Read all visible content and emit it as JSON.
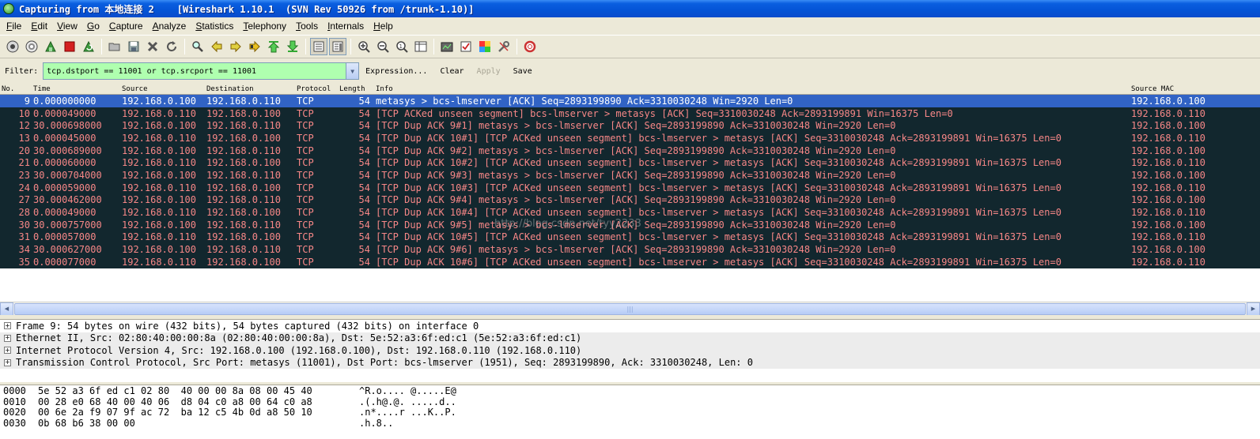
{
  "window": {
    "title": "Capturing from 本地连接 2    [Wireshark 1.10.1  (SVN Rev 50926 from /trunk-1.10)]"
  },
  "menu": [
    "File",
    "Edit",
    "View",
    "Go",
    "Capture",
    "Analyze",
    "Statistics",
    "Telephony",
    "Tools",
    "Internals",
    "Help"
  ],
  "filter": {
    "label": "Filter:",
    "value": "tcp.dstport == 11001 or tcp.srcport == 11001",
    "expression": "Expression...",
    "clear": "Clear",
    "apply": "Apply",
    "save": "Save"
  },
  "columns": [
    "No.",
    "Time",
    "Source",
    "Destination",
    "Protocol",
    "Length",
    "Info",
    "Source MAC"
  ],
  "packets": [
    {
      "no": "9",
      "time": "0.000000000",
      "src": "192.168.0.100",
      "dst": "192.168.0.110",
      "proto": "TCP",
      "len": "54",
      "info": "metasys > bcs-lmserver [ACK] Seq=2893199890 Ack=3310030248 Win=2920 Len=0",
      "mac": "192.168.0.100",
      "selected": true
    },
    {
      "no": "10",
      "time": "0.000049000",
      "src": "192.168.0.110",
      "dst": "192.168.0.100",
      "proto": "TCP",
      "len": "54",
      "info": "[TCP ACKed unseen segment] bcs-lmserver > metasys [ACK] Seq=3310030248 Ack=2893199891 Win=16375 Len=0",
      "mac": "192.168.0.110"
    },
    {
      "no": "12",
      "time": "30.000698000",
      "src": "192.168.0.100",
      "dst": "192.168.0.110",
      "proto": "TCP",
      "len": "54",
      "info": "[TCP Dup ACK 9#1] metasys > bcs-lmserver [ACK] Seq=2893199890 Ack=3310030248 Win=2920 Len=0",
      "mac": "192.168.0.100"
    },
    {
      "no": "13",
      "time": "0.000045000",
      "src": "192.168.0.110",
      "dst": "192.168.0.100",
      "proto": "TCP",
      "len": "54",
      "info": "[TCP Dup ACK 10#1] [TCP ACKed unseen segment] bcs-lmserver > metasys [ACK] Seq=3310030248 Ack=2893199891 Win=16375 Len=0",
      "mac": "192.168.0.110"
    },
    {
      "no": "20",
      "time": "30.000689000",
      "src": "192.168.0.100",
      "dst": "192.168.0.110",
      "proto": "TCP",
      "len": "54",
      "info": "[TCP Dup ACK 9#2] metasys > bcs-lmserver [ACK] Seq=2893199890 Ack=3310030248 Win=2920 Len=0",
      "mac": "192.168.0.100"
    },
    {
      "no": "21",
      "time": "0.000060000",
      "src": "192.168.0.110",
      "dst": "192.168.0.100",
      "proto": "TCP",
      "len": "54",
      "info": "[TCP Dup ACK 10#2] [TCP ACKed unseen segment] bcs-lmserver > metasys [ACK] Seq=3310030248 Ack=2893199891 Win=16375 Len=0",
      "mac": "192.168.0.110"
    },
    {
      "no": "23",
      "time": "30.000704000",
      "src": "192.168.0.100",
      "dst": "192.168.0.110",
      "proto": "TCP",
      "len": "54",
      "info": "[TCP Dup ACK 9#3] metasys > bcs-lmserver [ACK] Seq=2893199890 Ack=3310030248 Win=2920 Len=0",
      "mac": "192.168.0.100"
    },
    {
      "no": "24",
      "time": "0.000059000",
      "src": "192.168.0.110",
      "dst": "192.168.0.100",
      "proto": "TCP",
      "len": "54",
      "info": "[TCP Dup ACK 10#3] [TCP ACKed unseen segment] bcs-lmserver > metasys [ACK] Seq=3310030248 Ack=2893199891 Win=16375 Len=0",
      "mac": "192.168.0.110"
    },
    {
      "no": "27",
      "time": "30.000462000",
      "src": "192.168.0.100",
      "dst": "192.168.0.110",
      "proto": "TCP",
      "len": "54",
      "info": "[TCP Dup ACK 9#4] metasys > bcs-lmserver [ACK] Seq=2893199890 Ack=3310030248 Win=2920 Len=0",
      "mac": "192.168.0.100"
    },
    {
      "no": "28",
      "time": "0.000049000",
      "src": "192.168.0.110",
      "dst": "192.168.0.100",
      "proto": "TCP",
      "len": "54",
      "info": "[TCP Dup ACK 10#4] [TCP ACKed unseen segment] bcs-lmserver > metasys [ACK] Seq=3310030248 Ack=2893199891 Win=16375 Len=0",
      "mac": "192.168.0.110"
    },
    {
      "no": "30",
      "time": "30.000757000",
      "src": "192.168.0.100",
      "dst": "192.168.0.110",
      "proto": "TCP",
      "len": "54",
      "info": "[TCP Dup ACK 9#5] metasys > bcs-lmserver [ACK] Seq=2893199890 Ack=3310030248 Win=2920 Len=0",
      "mac": "192.168.0.100"
    },
    {
      "no": "31",
      "time": "0.000057000",
      "src": "192.168.0.110",
      "dst": "192.168.0.100",
      "proto": "TCP",
      "len": "54",
      "info": "[TCP Dup ACK 10#5] [TCP ACKed unseen segment] bcs-lmserver > metasys [ACK] Seq=3310030248 Ack=2893199891 Win=16375 Len=0",
      "mac": "192.168.0.110"
    },
    {
      "no": "34",
      "time": "30.000627000",
      "src": "192.168.0.100",
      "dst": "192.168.0.110",
      "proto": "TCP",
      "len": "54",
      "info": "[TCP Dup ACK 9#6] metasys > bcs-lmserver [ACK] Seq=2893199890 Ack=3310030248 Win=2920 Len=0",
      "mac": "192.168.0.100"
    },
    {
      "no": "35",
      "time": "0.000077000",
      "src": "192.168.0.110",
      "dst": "192.168.0.100",
      "proto": "TCP",
      "len": "54",
      "info": "[TCP Dup ACK 10#6] [TCP ACKed unseen segment] bcs-lmserver > metasys [ACK] Seq=3310030248 Ack=2893199891 Win=16375 Len=0",
      "mac": "192.168.0.110"
    }
  ],
  "details": [
    "Frame 9: 54 bytes on wire (432 bits), 54 bytes captured (432 bits) on interface 0",
    "Ethernet II, Src: 02:80:40:00:00:8a (02:80:40:00:00:8a), Dst: 5e:52:a3:6f:ed:c1 (5e:52:a3:6f:ed:c1)",
    "Internet Protocol Version 4, Src: 192.168.0.100 (192.168.0.100), Dst: 192.168.0.110 (192.168.0.110)",
    "Transmission Control Protocol, Src Port: metasys (11001), Dst Port: bcs-lmserver (1951), Seq: 2893199890, Ack: 3310030248, Len: 0"
  ],
  "hex": [
    {
      "offset": "0000",
      "bytes": "5e 52 a3 6f ed c1 02 80  40 00 00 8a 08 00 45 40",
      "ascii": "^R.o.... @.....E@"
    },
    {
      "offset": "0010",
      "bytes": "00 28 e0 68 40 00 40 06  d8 04 c0 a8 00 64 c0 a8",
      "ascii": ".(.h@.@. .....d.."
    },
    {
      "offset": "0020",
      "bytes": "00 6e 2a f9 07 9f ac 72  ba 12 c5 4b 0d a8 50 10",
      "ascii": ".n*....r ...K..P."
    },
    {
      "offset": "0030",
      "bytes": "0b 68 b6 38 00 00",
      "ascii": ".h.8.."
    }
  ],
  "watermark": "http://blog.csdn.net/tyy2233",
  "colors": {
    "row_bg": "#12272e",
    "row_fg": "#f78787",
    "selected_bg": "#3163c5",
    "filter_bg": "#afffaf",
    "titlebar": "#0554d6"
  },
  "toolbar_icons": [
    "interfaces-icon",
    "options-icon",
    "start-capture-icon",
    "stop-capture-icon",
    "restart-capture-icon",
    "open-icon",
    "save-icon",
    "close-file-icon",
    "reload-icon",
    "find-icon",
    "back-icon",
    "forward-icon",
    "goto-icon",
    "first-packet-icon",
    "last-packet-icon",
    "colorize-icon",
    "autoscroll-icon",
    "zoom-in-icon",
    "zoom-out-icon",
    "zoom-normal-icon",
    "resize-columns-icon",
    "capture-filters-icon",
    "display-filters-icon",
    "coloring-rules-icon",
    "preferences-icon",
    "help-icon"
  ]
}
